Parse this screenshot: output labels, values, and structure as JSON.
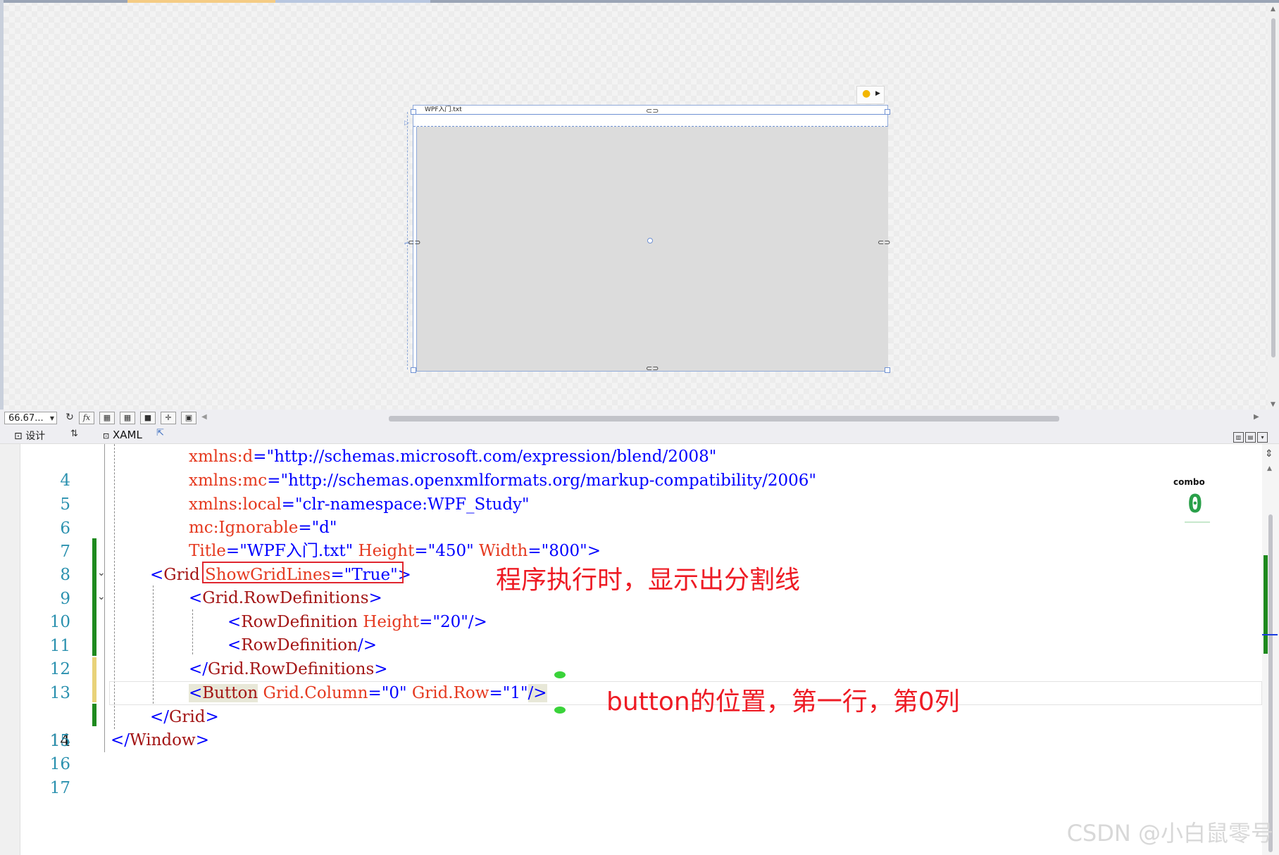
{
  "designer": {
    "window_title": "WPF入门.txt",
    "ruler_number": "1"
  },
  "design_toolbar": {
    "zoom_value": "66.67...",
    "fx_label": "fx"
  },
  "tabs": {
    "design_label": "设计",
    "swap_label": "⇅",
    "xaml_label": "XAML"
  },
  "editor": {
    "lines": [
      {
        "num": "4",
        "code": "xmlns:d=\"http://schemas.microsoft.com/expression/blend/2008\""
      },
      {
        "num": "5",
        "code": "xmlns:mc=\"http://schemas.openxmlformats.org/markup-compatibility/2006\""
      },
      {
        "num": "6",
        "code": "xmlns:local=\"clr-namespace:WPF_Study\""
      },
      {
        "num": "7",
        "code": "mc:Ignorable=\"d\""
      },
      {
        "num": "8",
        "code": "Title=\"WPF入门.txt\" Height=\"450\" Width=\"800\">"
      },
      {
        "num": "9",
        "code": "<Grid ShowGridLines=\"True\">"
      },
      {
        "num": "10",
        "code": "<Grid.RowDefinitions>"
      },
      {
        "num": "11",
        "code": "<RowDefinition Height=\"20\"/>"
      },
      {
        "num": "12",
        "code": "<RowDefinition/>"
      },
      {
        "num": "13",
        "code": "</Grid.RowDefinitions>"
      },
      {
        "num": "14",
        "code": "<Button Grid.Column=\"0\" Grid.Row=\"1\"/>"
      },
      {
        "num": "15",
        "code": "</Grid>"
      },
      {
        "num": "16",
        "code": "</Window>"
      },
      {
        "num": "17",
        "code": ""
      }
    ],
    "annotation_1": "程序执行时，显示出分割线",
    "annotation_2": "button的位置，第一行，第0列"
  },
  "combo": {
    "label": "combo",
    "value": "0"
  },
  "watermark": "CSDN @小白鼠零号",
  "colors": {
    "annotation_red": "#ee1b24",
    "xaml_tag": "#a31515",
    "xaml_attr": "#ff0000",
    "xaml_value": "#0000ff",
    "line_number": "#2b91af",
    "change_green": "#1e8a1e",
    "change_yellow": "#e8d278"
  }
}
